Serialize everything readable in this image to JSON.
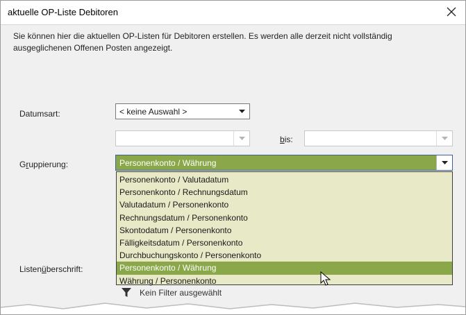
{
  "dialog": {
    "title": "aktuelle OP-Liste Debitoren",
    "close_glyph": "✕"
  },
  "intro": "Sie können hier die aktuellen OP-Listen für Debitoren erstellen. Es werden alle derzeit nicht vollständig ausgeglichenen Offenen Posten angezeigt.",
  "fields": {
    "datumsart": {
      "label": "Datumsart:",
      "value": "< keine Auswahl >"
    },
    "von": {
      "value": ""
    },
    "bis": {
      "label_u": "b",
      "label_rest": "is:",
      "value": ""
    },
    "gruppierung": {
      "label_pre": "G",
      "label_u": "r",
      "label_post": "uppierung:",
      "value": "Personenkonto / Währung"
    },
    "listenueberschrift": {
      "label_pre": "Listen",
      "label_u": "ü",
      "label_post": "berschrift:"
    }
  },
  "dropdown": {
    "options": [
      "Personenkonto / Valutadatum",
      "Personenkonto / Rechnungsdatum",
      "Valutadatum / Personenkonto",
      "Rechnungsdatum / Personenkonto",
      "Skontodatum / Personenkonto",
      "Fälligkeitsdatum / Personenkonto",
      "Durchbuchungskonto / Personenkonto",
      "Personenkonto / Währung",
      "Währung / Personenkonto"
    ],
    "selected_index": 7
  },
  "filter": {
    "label": "Kein Filter ausgewählt",
    "icon": "funnel-icon"
  },
  "colors": {
    "selection": "#8aa84a",
    "dropdown_bg": "#e7e9c7",
    "dialog_bg": "#f0f0f0"
  }
}
